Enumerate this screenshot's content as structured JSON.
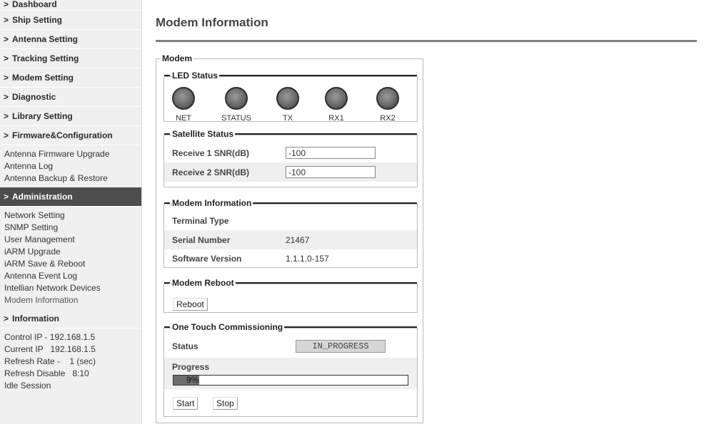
{
  "sidebar": {
    "dashboard": "Dashboard",
    "ship_setting": "Ship Setting",
    "antenna_setting": "Antenna Setting",
    "tracking_setting": "Tracking Setting",
    "modem_setting": "Modem Setting",
    "diagnostic": "Diagnostic",
    "library_setting": "Library Setting",
    "firmware_configuration": "Firmware&Configuration",
    "firmware_items": [
      "Antenna Firmware Upgrade",
      "Antenna Log",
      "Antenna Backup & Restore"
    ],
    "administration": "Administration",
    "admin_items": [
      "Network Setting",
      "SNMP Setting",
      "User Management",
      "iARM Upgrade",
      "iARM Save & Reboot",
      "Antenna Event Log",
      "Intellian Network Devices",
      "Modem Information"
    ],
    "information": "Information",
    "info_items": [
      "Control IP - 192.168.1.5",
      "Current IP   192.168.1.5",
      "Refresh Rate -    1 (sec)",
      "Refresh Disable   8:10",
      "Idle Session"
    ]
  },
  "main": {
    "title": "Modem Information",
    "modem_legend": "Modem",
    "led_status": {
      "title": "LED Status",
      "leds": [
        "NET",
        "STATUS",
        "TX",
        "RX1",
        "RX2"
      ]
    },
    "satellite_status": {
      "title": "Satellite Status",
      "rows": [
        {
          "label": "Receive 1 SNR(dB)",
          "value": "-100"
        },
        {
          "label": "Receive 2 SNR(dB)",
          "value": "-100"
        }
      ]
    },
    "modem_information": {
      "title": "Modem Information",
      "rows": [
        {
          "label": "Terminal Type",
          "value": ""
        },
        {
          "label": "Serial Number",
          "value": "21467"
        },
        {
          "label": "Software Version",
          "value": "1.1.1.0-157"
        }
      ]
    },
    "modem_reboot": {
      "title": "Modem Reboot",
      "button": "Reboot"
    },
    "one_touch": {
      "title": "One Touch Commissioning",
      "status_label": "Status",
      "status_value": "IN_PROGRESS",
      "progress_label": "Progress",
      "progress_text": "9%",
      "progress_value": 0.09,
      "start": "Start",
      "stop": "Stop"
    }
  },
  "colors": {
    "active_nav": "#4d4d4d",
    "sidebar_bg": "#f0f0f0",
    "title_rule": "#808080"
  },
  "icons": {
    "nav_expand": "chevron-right-icon"
  }
}
